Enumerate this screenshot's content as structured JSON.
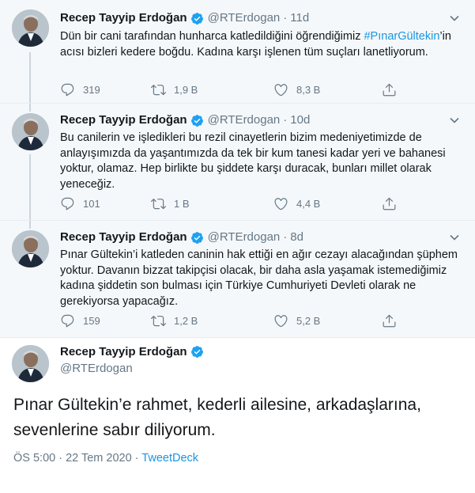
{
  "author": {
    "name": "Recep Tayyip Erdoğan",
    "handle": "@RTErdogan"
  },
  "colors": {
    "link": "#1b95e0",
    "verified": "#1da1f2",
    "muted": "#657786"
  },
  "tweets": [
    {
      "time": "11d",
      "text_before": "Dün bir cani tarafından hunharca katledildiğini öğrendiğimiz ",
      "hashtag": "#PınarGültekin",
      "text_after": "’in acısı bizleri kedere boğdu. Kadına karşı işlenen tüm suçları lanetliyorum.",
      "replies": "319",
      "retweets": "1,9 B",
      "likes": "8,3 B"
    },
    {
      "time": "10d",
      "text": "Bu canilerin ve işledikleri bu rezil cinayetlerin bizim medeniyetimizde de anlayışımızda da yaşantımızda da tek bir kum tanesi kadar yeri ve bahanesi yoktur, olamaz. Hep birlikte bu şiddete karşı duracak, bunları millet olarak yeneceğiz.",
      "replies": "101",
      "retweets": "1 B",
      "likes": "4,4 B"
    },
    {
      "time": "8d",
      "text": "Pınar Gültekin’i katleden caninin hak ettiği en ağır cezayı alacağından şüphem yoktur. Davanın bizzat takipçisi olacak, bir daha asla yaşamak istemediğimiz kadına şiddetin son bulması için Türkiye Cumhuriyeti Devleti olarak ne gerekiyorsa yapacağız.",
      "replies": "159",
      "retweets": "1,2 B",
      "likes": "5,2 B"
    }
  ],
  "main": {
    "text": "Pınar Gültekin’e rahmet, kederli ailesine, arkadaşlarına, sevenlerine sabır diliyorum.",
    "timestamp": "ÖS 5:00 · 22 Tem 2020 · ",
    "source": "TweetDeck"
  },
  "icons": {
    "reply": "reply-icon",
    "retweet": "retweet-icon",
    "like": "heart-icon",
    "share": "share-icon",
    "more": "chevron-down-icon",
    "verified": "verified-badge-icon"
  }
}
